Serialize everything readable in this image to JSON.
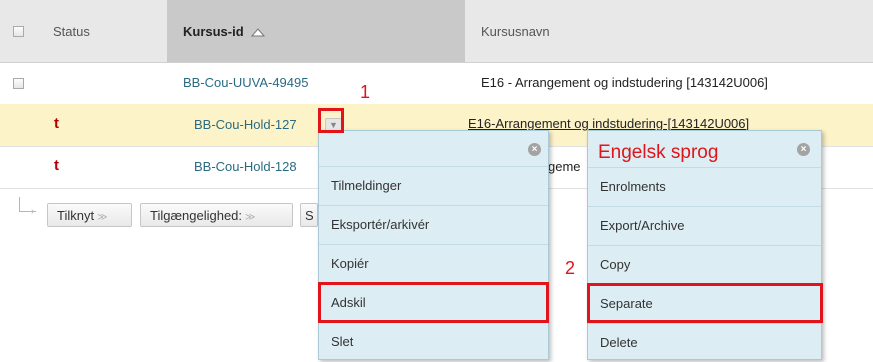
{
  "table": {
    "headers": {
      "status": "Status",
      "course_id": "Kursus-id",
      "course_name": "Kursusnavn"
    },
    "rows": [
      {
        "id": "BB-Cou-UUVA-49495",
        "name": "E16 - Arrangement og indstudering [143142U006]"
      },
      {
        "id": "BB-Cou-Hold-127",
        "name": "E16-Arrangement og indstudering-[143142U006]"
      },
      {
        "id": "BB-Cou-Hold-128",
        "name": "geme"
      }
    ],
    "status_glyph": "t"
  },
  "toolbar": {
    "attach": "Tilknyt",
    "availability": "Tilgængelighed:",
    "partial": "S"
  },
  "menu_da": {
    "items": [
      "Tilmeldinger",
      "Eksportér/arkivér",
      "Kopiér",
      "Adskil",
      "Slet"
    ]
  },
  "menu_en": {
    "title": "Engelsk sprog",
    "items": [
      "Enrolments",
      "Export/Archive",
      "Copy",
      "Separate",
      "Delete"
    ]
  },
  "annotations": {
    "step1": "1",
    "step2": "2"
  },
  "colors": {
    "annotation_red": "#e0141a",
    "link_teal": "#2a6b82",
    "menu_bg": "#dcedf3",
    "selected_row": "#fdf3c8"
  }
}
